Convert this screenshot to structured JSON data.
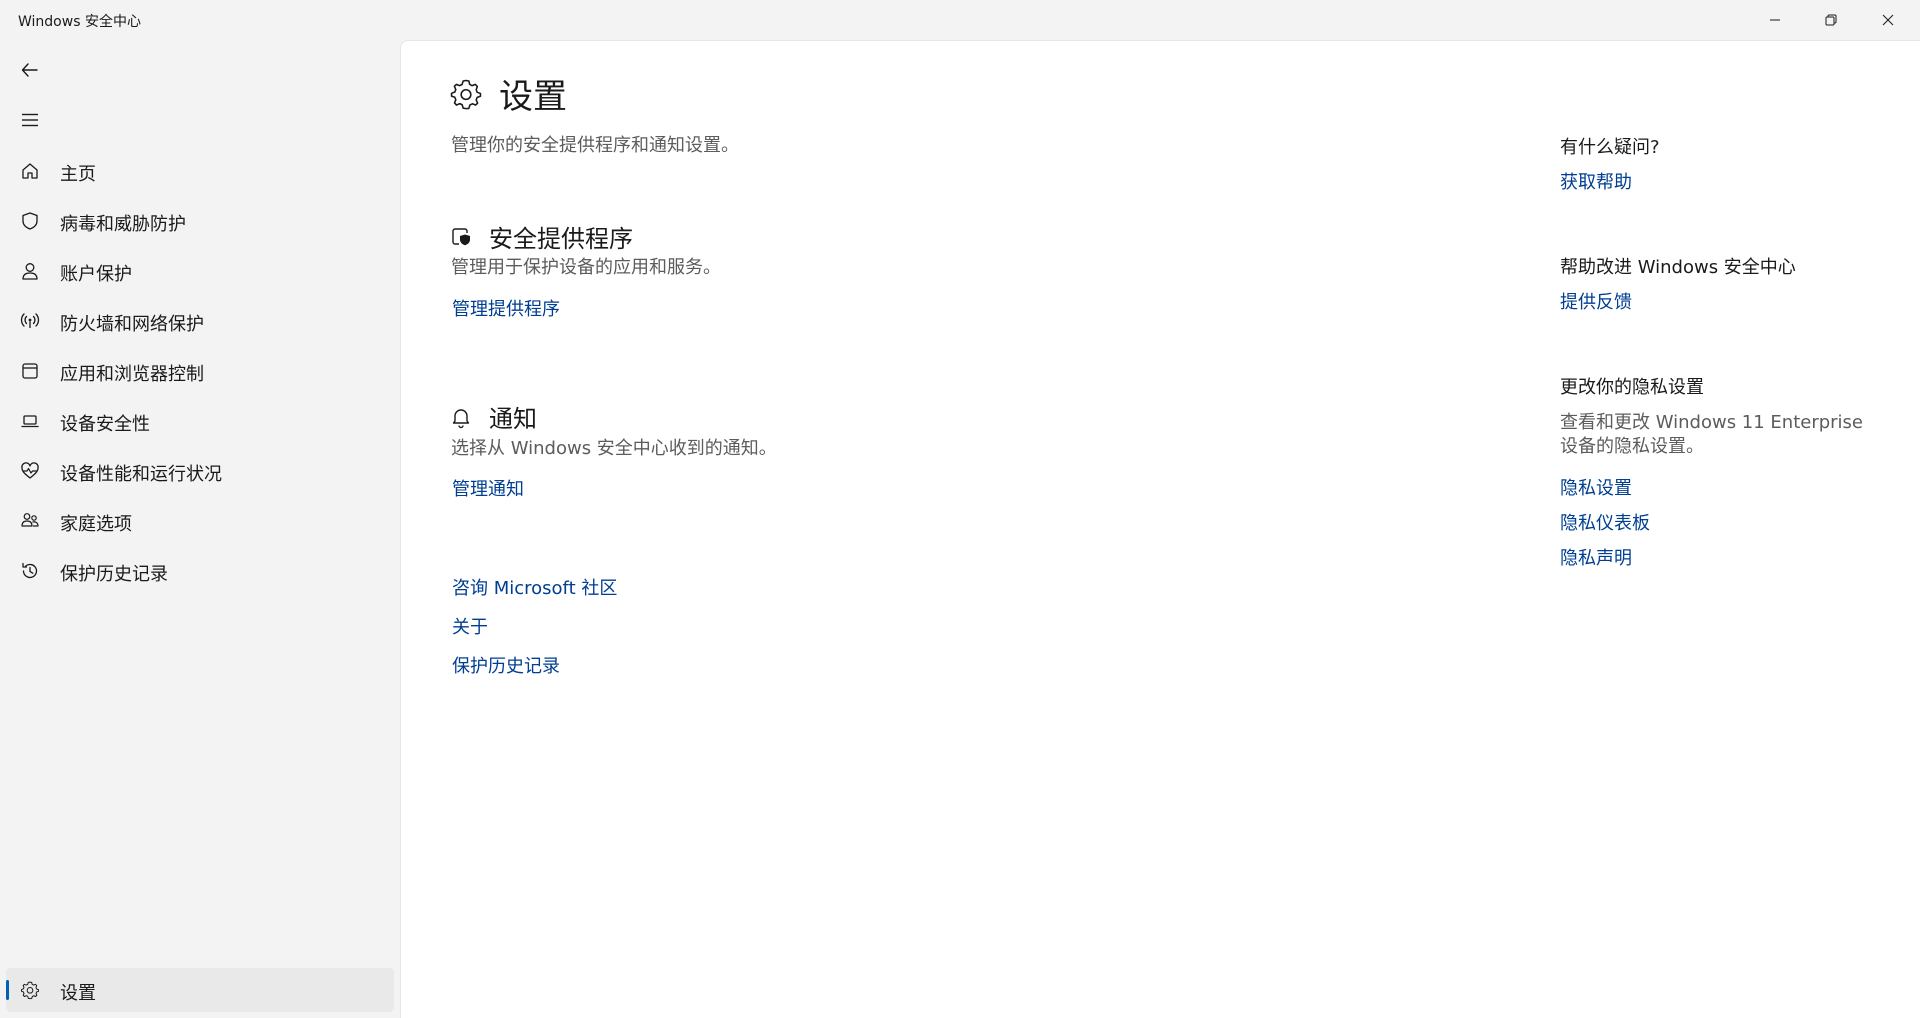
{
  "window": {
    "title": "Windows 安全中心",
    "controls": [
      "minimize",
      "restore",
      "close"
    ]
  },
  "sidebar": {
    "items": [
      {
        "label": "主页",
        "icon": "home-icon"
      },
      {
        "label": "病毒和威胁防护",
        "icon": "shield-icon"
      },
      {
        "label": "账户保护",
        "icon": "person-icon"
      },
      {
        "label": "防火墙和网络保护",
        "icon": "wifi-signal-icon"
      },
      {
        "label": "应用和浏览器控制",
        "icon": "browser-window-icon"
      },
      {
        "label": "设备安全性",
        "icon": "laptop-icon"
      },
      {
        "label": "设备性能和运行状况",
        "icon": "heart-pulse-icon"
      },
      {
        "label": "家庭选项",
        "icon": "family-icon"
      },
      {
        "label": "保护历史记录",
        "icon": "history-icon"
      }
    ],
    "settings": {
      "label": "设置",
      "icon": "gear-icon",
      "selected": true
    }
  },
  "main": {
    "title": "设置",
    "description": "管理你的安全提供程序和通知设置。",
    "sections": [
      {
        "title": "安全提供程序",
        "icon": "security-provider-icon",
        "description": "管理用于保护设备的应用和服务。",
        "link": "管理提供程序"
      },
      {
        "title": "通知",
        "icon": "bell-icon",
        "description": "选择从 Windows 安全中心收到的通知。",
        "link": "管理通知"
      }
    ],
    "footer_links": [
      "咨询 Microsoft 社区",
      "关于",
      "保护历史记录"
    ]
  },
  "aside": {
    "question": {
      "heading": "有什么疑问?",
      "link": "获取帮助"
    },
    "improve": {
      "heading": "帮助改进 Windows 安全中心",
      "link": "提供反馈"
    },
    "privacy": {
      "heading": "更改你的隐私设置",
      "text": "查看和更改 Windows 11 Enterprise 设备的隐私设置。",
      "links": [
        "隐私设置",
        "隐私仪表板",
        "隐私声明"
      ]
    }
  },
  "colors": {
    "accent": "#005fb8",
    "link": "#003e92",
    "sidebar_bg": "#f3f3f3",
    "content_bg": "#ffffff",
    "secondary_text": "#5c5c5c"
  }
}
